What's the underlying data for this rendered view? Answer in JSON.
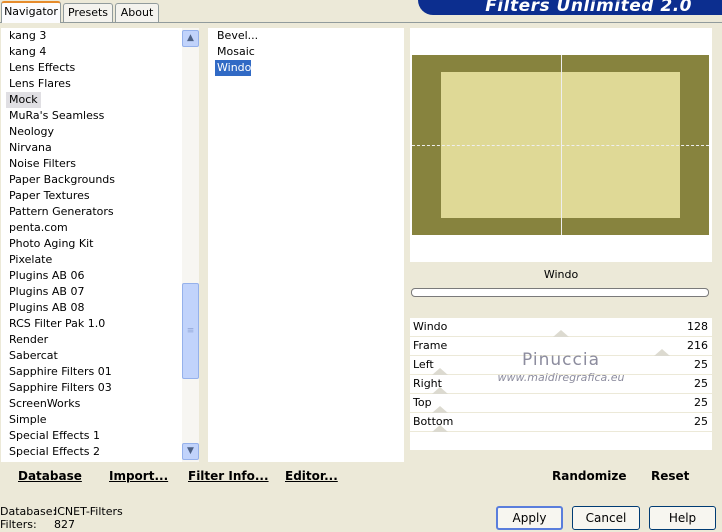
{
  "tabs": [
    "Navigator",
    "Presets",
    "About"
  ],
  "banner": "Filters Unlimited 2.0",
  "categories": [
    "kang 3",
    "kang 4",
    "Lens Effects",
    "Lens Flares",
    "Mock",
    "MuRa's Seamless",
    "Neology",
    "Nirvana",
    "Noise Filters",
    "Paper Backgrounds",
    "Paper Textures",
    "Pattern Generators",
    "penta.com",
    "Photo Aging Kit",
    "Pixelate",
    "Plugins AB 06",
    "Plugins AB 07",
    "Plugins AB 08",
    "RCS Filter Pak 1.0",
    "Render",
    "Sabercat",
    "Sapphire Filters 01",
    "Sapphire Filters 03",
    "ScreenWorks",
    "Simple",
    "Special Effects 1",
    "Special Effects 2"
  ],
  "selected_category": "Mock",
  "filters": [
    "Bevel...",
    "Mosaic",
    "Windo"
  ],
  "selected_filter": "Windo",
  "filter_name": "Windo",
  "sliders": [
    {
      "label": "Windo",
      "value": "128"
    },
    {
      "label": "Frame",
      "value": "216"
    },
    {
      "label": "Left",
      "value": "25"
    },
    {
      "label": "Right",
      "value": "25"
    },
    {
      "label": "Top",
      "value": "25"
    },
    {
      "label": "Bottom",
      "value": "25"
    }
  ],
  "watermark": {
    "name": "Pinuccia",
    "site": "www.maidiregrafica.eu"
  },
  "toolbar": {
    "database": "Database",
    "import": "Import...",
    "filter_info": "Filter Info...",
    "editor": "Editor...",
    "randomize": "Randomize",
    "reset": "Reset"
  },
  "status": {
    "database_label": "Database:",
    "database_value": "ICNET-Filters",
    "filters_label": "Filters:",
    "filters_value": "827"
  },
  "buttons": {
    "apply": "Apply",
    "cancel": "Cancel",
    "help": "Help"
  },
  "colors": {
    "frame": "#87833e",
    "inner": "#dfd996",
    "selection": "#316ac5",
    "banner": "#0c2e8f"
  }
}
